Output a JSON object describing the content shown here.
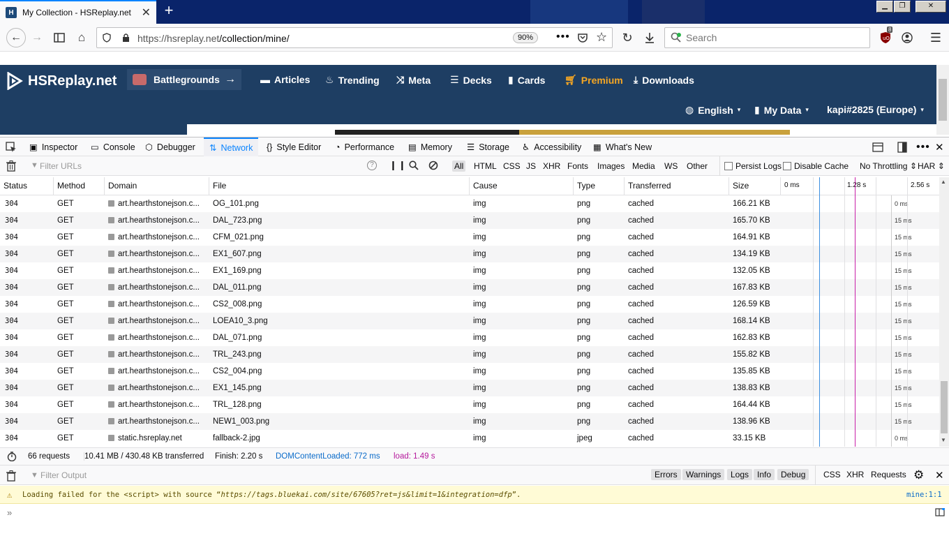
{
  "browser": {
    "tab_title": "My Collection - HSReplay.net",
    "new_tab": "+",
    "url_host": "https://hsreplay.net",
    "url_path": "/collection/mine/",
    "zoom": "90%",
    "search_placeholder": "Search",
    "ublock_count": "8"
  },
  "site": {
    "logo": "HSReplay.net",
    "battlegrounds": "Battlegrounds",
    "nav": [
      "Articles",
      "Trending",
      "Meta",
      "Decks",
      "Cards",
      "Premium",
      "Downloads"
    ],
    "language": "English",
    "my_data": "My Data",
    "account": "kapi#2825 (Europe)",
    "premium_color": "#f5a623"
  },
  "devtools": {
    "tabs": [
      "Inspector",
      "Console",
      "Debugger",
      "Network",
      "Style Editor",
      "Performance",
      "Memory",
      "Storage",
      "Accessibility",
      "What's New"
    ],
    "selected_tab": "Network",
    "filter_placeholder": "Filter URLs",
    "type_filters": [
      "All",
      "HTML",
      "CSS",
      "JS",
      "XHR",
      "Fonts",
      "Images",
      "Media",
      "WS",
      "Other"
    ],
    "persist_logs": "Persist Logs",
    "disable_cache": "Disable Cache",
    "throttling": "No Throttling",
    "har": "HAR",
    "columns": [
      "Status",
      "Method",
      "Domain",
      "File",
      "Cause",
      "Type",
      "Transferred",
      "Size"
    ],
    "waterfall_ticks": [
      "0 ms",
      "1.28 s",
      "2.56 s"
    ],
    "rows": [
      {
        "status": "304",
        "method": "GET",
        "domain": "art.hearthstonejson.c...",
        "file": "OG_101.png",
        "cause": "img",
        "type": "png",
        "transferred": "cached",
        "size": "166.21 KB",
        "time": "0 ms"
      },
      {
        "status": "304",
        "method": "GET",
        "domain": "art.hearthstonejson.c...",
        "file": "DAL_723.png",
        "cause": "img",
        "type": "png",
        "transferred": "cached",
        "size": "165.70 KB",
        "time": "15 ms"
      },
      {
        "status": "304",
        "method": "GET",
        "domain": "art.hearthstonejson.c...",
        "file": "CFM_021.png",
        "cause": "img",
        "type": "png",
        "transferred": "cached",
        "size": "164.91 KB",
        "time": "15 ms"
      },
      {
        "status": "304",
        "method": "GET",
        "domain": "art.hearthstonejson.c...",
        "file": "EX1_607.png",
        "cause": "img",
        "type": "png",
        "transferred": "cached",
        "size": "134.19 KB",
        "time": "15 ms"
      },
      {
        "status": "304",
        "method": "GET",
        "domain": "art.hearthstonejson.c...",
        "file": "EX1_169.png",
        "cause": "img",
        "type": "png",
        "transferred": "cached",
        "size": "132.05 KB",
        "time": "15 ms"
      },
      {
        "status": "304",
        "method": "GET",
        "domain": "art.hearthstonejson.c...",
        "file": "DAL_011.png",
        "cause": "img",
        "type": "png",
        "transferred": "cached",
        "size": "167.83 KB",
        "time": "15 ms"
      },
      {
        "status": "304",
        "method": "GET",
        "domain": "art.hearthstonejson.c...",
        "file": "CS2_008.png",
        "cause": "img",
        "type": "png",
        "transferred": "cached",
        "size": "126.59 KB",
        "time": "15 ms"
      },
      {
        "status": "304",
        "method": "GET",
        "domain": "art.hearthstonejson.c...",
        "file": "LOEA10_3.png",
        "cause": "img",
        "type": "png",
        "transferred": "cached",
        "size": "168.14 KB",
        "time": "15 ms"
      },
      {
        "status": "304",
        "method": "GET",
        "domain": "art.hearthstonejson.c...",
        "file": "DAL_071.png",
        "cause": "img",
        "type": "png",
        "transferred": "cached",
        "size": "162.83 KB",
        "time": "15 ms"
      },
      {
        "status": "304",
        "method": "GET",
        "domain": "art.hearthstonejson.c...",
        "file": "TRL_243.png",
        "cause": "img",
        "type": "png",
        "transferred": "cached",
        "size": "155.82 KB",
        "time": "15 ms"
      },
      {
        "status": "304",
        "method": "GET",
        "domain": "art.hearthstonejson.c...",
        "file": "CS2_004.png",
        "cause": "img",
        "type": "png",
        "transferred": "cached",
        "size": "135.85 KB",
        "time": "15 ms"
      },
      {
        "status": "304",
        "method": "GET",
        "domain": "art.hearthstonejson.c...",
        "file": "EX1_145.png",
        "cause": "img",
        "type": "png",
        "transferred": "cached",
        "size": "138.83 KB",
        "time": "15 ms"
      },
      {
        "status": "304",
        "method": "GET",
        "domain": "art.hearthstonejson.c...",
        "file": "TRL_128.png",
        "cause": "img",
        "type": "png",
        "transferred": "cached",
        "size": "164.44 KB",
        "time": "15 ms"
      },
      {
        "status": "304",
        "method": "GET",
        "domain": "art.hearthstonejson.c...",
        "file": "NEW1_003.png",
        "cause": "img",
        "type": "png",
        "transferred": "cached",
        "size": "138.96 KB",
        "time": "15 ms"
      },
      {
        "status": "304",
        "method": "GET",
        "domain": "static.hsreplay.net",
        "file": "fallback-2.jpg",
        "cause": "img",
        "type": "jpeg",
        "transferred": "cached",
        "size": "33.15 KB",
        "time": "0 ms"
      }
    ],
    "summary": {
      "requests": "66 requests",
      "transferred": "10.41 MB / 430.48 KB transferred",
      "finish": "Finish: 2.20 s",
      "domcontentloaded": "DOMContentLoaded: 772 ms",
      "load": "load: 1.49 s"
    },
    "console": {
      "filter_placeholder": "Filter Output",
      "levels": [
        "Errors",
        "Warnings",
        "Logs",
        "Info",
        "Debug"
      ],
      "extras": [
        "CSS",
        "XHR",
        "Requests"
      ],
      "warning_pre": "Loading failed for the <script> with source “",
      "warning_url": "https://tags.bluekai.com/site/67605?ret=js&limit=1&integration=dfp",
      "warning_post": "”.",
      "warning_location": "mine:1:1"
    }
  }
}
